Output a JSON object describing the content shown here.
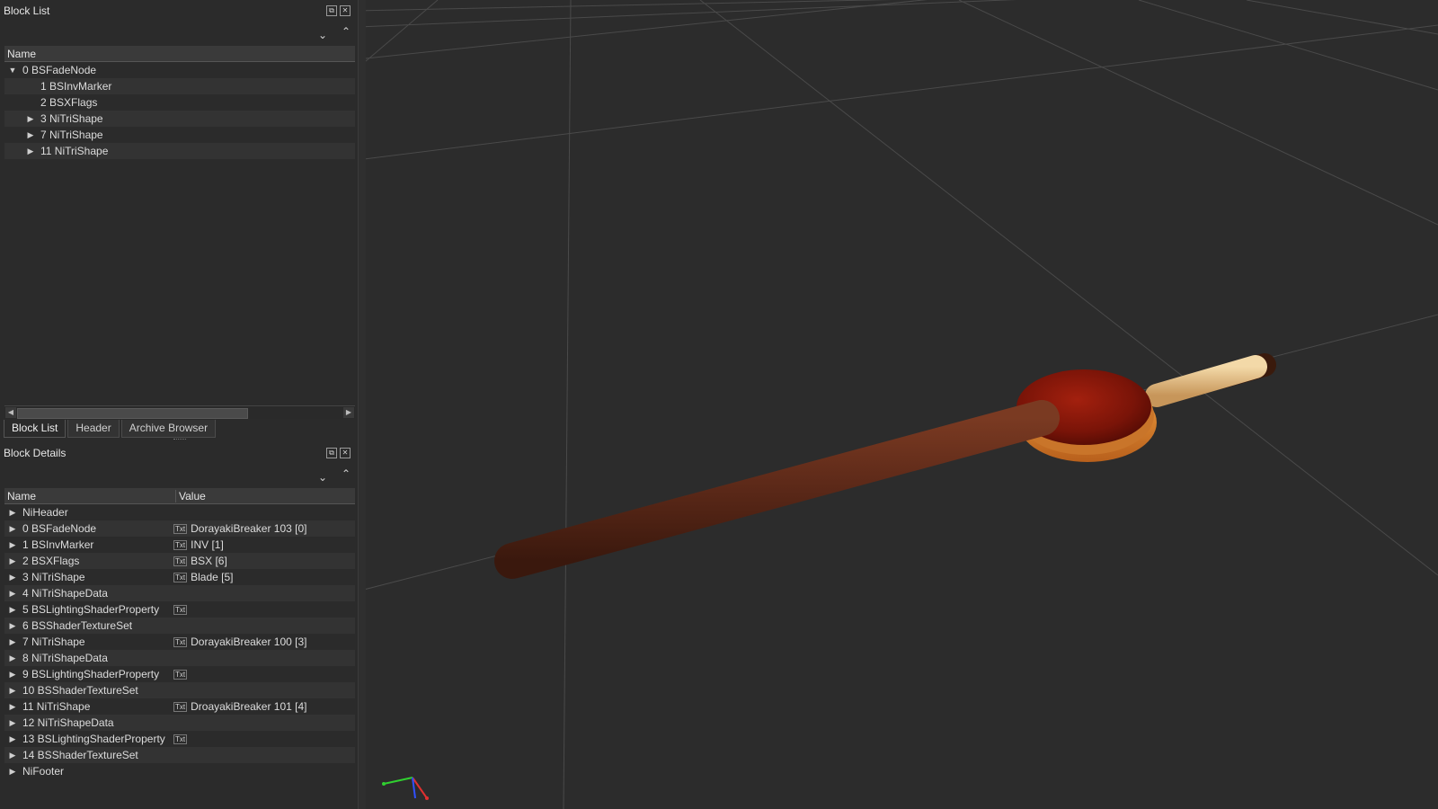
{
  "block_list": {
    "title": "Block List",
    "column_name": "Name",
    "items": [
      {
        "label": "0 BSFadeNode",
        "level": 0,
        "arrow": "▼"
      },
      {
        "label": "1 BSInvMarker",
        "level": 1,
        "arrow": ""
      },
      {
        "label": "2 BSXFlags",
        "level": 1,
        "arrow": ""
      },
      {
        "label": "3 NiTriShape",
        "level": 1,
        "arrow": "▶"
      },
      {
        "label": "7 NiTriShape",
        "level": 1,
        "arrow": "▶"
      },
      {
        "label": "11 NiTriShape",
        "level": 1,
        "arrow": "▶"
      }
    ]
  },
  "tabs": [
    {
      "label": "Block List",
      "active": true
    },
    {
      "label": "Header",
      "active": false
    },
    {
      "label": "Archive Browser",
      "active": false
    }
  ],
  "block_details": {
    "title": "Block Details",
    "column_name": "Name",
    "column_value": "Value",
    "txt_icon": "Txt",
    "rows": [
      {
        "name": "NiHeader",
        "value": "",
        "icon": false
      },
      {
        "name": "0 BSFadeNode",
        "value": "DorayakiBreaker 103 [0]",
        "icon": true
      },
      {
        "name": "1 BSInvMarker",
        "value": "INV [1]",
        "icon": true
      },
      {
        "name": "2 BSXFlags",
        "value": "BSX [6]",
        "icon": true
      },
      {
        "name": "3 NiTriShape",
        "value": "Blade [5]",
        "icon": true
      },
      {
        "name": "4 NiTriShapeData",
        "value": "",
        "icon": false
      },
      {
        "name": "5 BSLightingShaderProperty",
        "value": "",
        "icon": true
      },
      {
        "name": "6 BSShaderTextureSet",
        "value": "",
        "icon": false
      },
      {
        "name": "7 NiTriShape",
        "value": "DorayakiBreaker 100 [3]",
        "icon": true
      },
      {
        "name": "8 NiTriShapeData",
        "value": "",
        "icon": false
      },
      {
        "name": "9 BSLightingShaderProperty",
        "value": "",
        "icon": true
      },
      {
        "name": "10 BSShaderTextureSet",
        "value": "",
        "icon": false
      },
      {
        "name": "11 NiTriShape",
        "value": "DroayakiBreaker 101 [4]",
        "icon": true
      },
      {
        "name": "12 NiTriShapeData",
        "value": "",
        "icon": false
      },
      {
        "name": "13 BSLightingShaderProperty",
        "value": "",
        "icon": true
      },
      {
        "name": "14 BSShaderTextureSet",
        "value": "",
        "icon": false
      },
      {
        "name": "NiFooter",
        "value": "",
        "icon": false
      }
    ]
  },
  "colors": {
    "panel_bg": "#2b2b2b",
    "viewport_bg": "#2c2c2c",
    "grid_line": "#4a4a4a",
    "handle_brown": "#5e2a19",
    "pancake_red": "#8a1a0c",
    "pancake_gold": "#d98a2a",
    "stick_tan": "#e0b57a",
    "axis_x": "#e03030",
    "axis_y": "#30d030",
    "axis_z": "#3050ff"
  },
  "icons": {
    "float": "float-icon",
    "close": "close-icon",
    "expand_all": "expand-all-icon",
    "collapse_all": "collapse-all-icon"
  }
}
